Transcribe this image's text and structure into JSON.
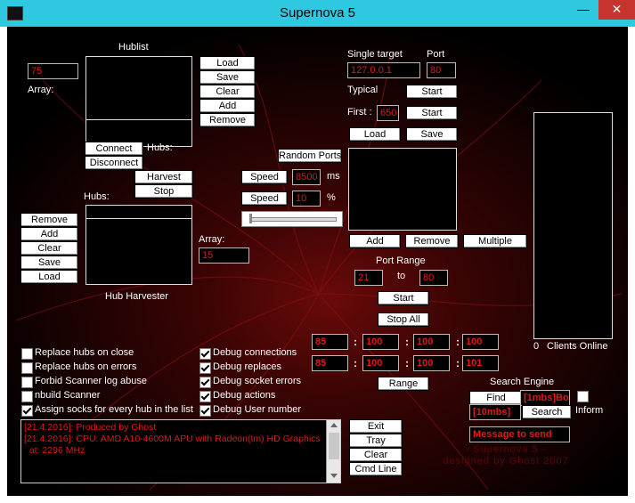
{
  "window": {
    "title": "Supernova 5",
    "minimize": "—",
    "close": "✕"
  },
  "hublist": {
    "title": "Hublist",
    "count": "75",
    "array_label": "Array:",
    "load": "Load",
    "save": "Save",
    "clear": "Clear",
    "add": "Add",
    "remove": "Remove",
    "connect": "Connect",
    "disconnect": "Disconnect",
    "hubs_label": "Hubs:",
    "harvest": "Harvest",
    "stop": "Stop"
  },
  "harvester": {
    "hubs_label": "Hubs:",
    "title": "Hub Harvester",
    "remove": "Remove",
    "add": "Add",
    "clear": "Clear",
    "save": "Save",
    "load": "Load",
    "array_label": "Array:",
    "array_value": "15"
  },
  "speed": {
    "random_ports": "Random Ports",
    "speed1_label": "Speed",
    "speed1_value": "8500",
    "speed1_unit": "ms",
    "speed2_label": "Speed",
    "speed2_value": "10",
    "speed2_unit": "%"
  },
  "target": {
    "single_label": "Single target",
    "port_label": "Port",
    "ip": "127.0.0.1",
    "port": "80",
    "typical_label": "Typical",
    "start1": "Start",
    "first_label": "First :",
    "first_value": "650",
    "start2": "Start",
    "load": "Load",
    "save": "Save",
    "add": "Add",
    "remove": "Remove",
    "multiple": "Multiple"
  },
  "port_range": {
    "label": "Port Range",
    "from": "21",
    "to_label": "to",
    "to": "80",
    "start": "Start",
    "stop_all": "Stop All",
    "range": "Range"
  },
  "ip_range": {
    "row1": [
      "85",
      "100",
      "100",
      "100"
    ],
    "row2": [
      "85",
      "100",
      "100",
      "101"
    ],
    "sep": ":"
  },
  "clients": {
    "count": "0",
    "label": "Clients Online"
  },
  "checkboxes_left": [
    {
      "label": "Replace hubs on close",
      "checked": false
    },
    {
      "label": "Replace hubs on errors",
      "checked": false
    },
    {
      "label": "Forbid Scanner log abuse",
      "checked": false
    },
    {
      "label": "nbuild Scanner",
      "checked": false
    },
    {
      "label": "Assign socks for every hub in the list",
      "checked": true
    }
  ],
  "checkboxes_right": [
    {
      "label": "Debug connections",
      "checked": true
    },
    {
      "label": "Debug replaces",
      "checked": true
    },
    {
      "label": "Debug socket errors",
      "checked": true
    },
    {
      "label": "Debug actions",
      "checked": true
    },
    {
      "label": "Debug User number",
      "checked": true
    }
  ],
  "log": {
    "lines": [
      "[21.4.2016]: Produced by Ghost",
      "[21.4.2016]: CPU: AMD A10-4600M APU with Radeon(tm) HD Graphics",
      "  at: 2296 MHz"
    ]
  },
  "log_buttons": {
    "exit": "Exit",
    "tray": "Tray",
    "clear": "Clear",
    "cmd_line": "Cmd Line"
  },
  "search": {
    "title": "Search Engine",
    "find": "Find",
    "find_field": "[1mbs]Bo",
    "field2": "[10mbs]",
    "search": "Search",
    "inform": "Inform",
    "message": "Message to send"
  },
  "credits": {
    "line1": "- Supernova 5 -",
    "line2": "designed by Ghost 2007"
  },
  "colors": {
    "accent_red": "#e01818",
    "title_bar": "#2ec8e0",
    "close_red": "#c7342e"
  }
}
